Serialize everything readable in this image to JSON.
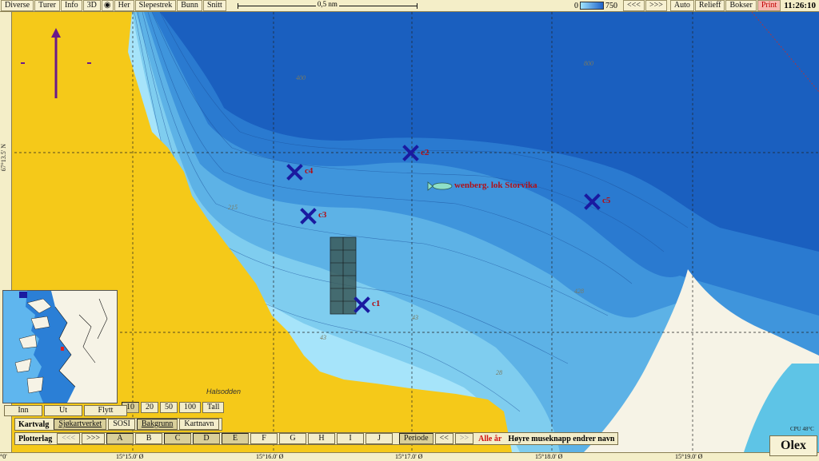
{
  "topbar": {
    "menus": [
      "Diverse",
      "Turer",
      "Info",
      "3D",
      "Her",
      "Slepestrek",
      "Bunn",
      "Snitt"
    ],
    "scale_label": "0,5 nm",
    "depth_min": "0",
    "depth_max": "750",
    "nav_back": "<<<",
    "nav_fwd": ">>>",
    "right_buttons": [
      "Auto",
      "Relieff",
      "Bokser"
    ],
    "print": "Print",
    "clock": "11:26:10"
  },
  "ruler": {
    "latitude": "67°13.5' N",
    "longitudes": [
      "°0'",
      "15°15.0' Ø",
      "15°16.0' Ø",
      "15°17.0' Ø",
      "15°18.0' Ø",
      "15°19.0' Ø"
    ]
  },
  "markers": [
    {
      "label": "c1"
    },
    {
      "label": "c2"
    },
    {
      "label": "c3"
    },
    {
      "label": "c4"
    },
    {
      "label": "c5"
    }
  ],
  "fish_label": "wenberg. lok Storvika",
  "depth_labels": [
    "43",
    "43",
    "28",
    "215",
    "428",
    "400",
    "800"
  ],
  "place_name": "Halsodden",
  "zoom_panel": {
    "scales": [
      "10",
      "20",
      "50",
      "100",
      "Tall"
    ],
    "actions": [
      "Inn",
      "Ut",
      "Flytt"
    ]
  },
  "kartvalg": {
    "label": "Kartvalg",
    "options": [
      "Sjøkartverket",
      "SOSI",
      "Bakgrunn",
      "Kartnavn"
    ]
  },
  "plotterlag": {
    "label": "Plotterlag",
    "back": "<<<",
    "fwd": ">>>",
    "layers": [
      "A",
      "B",
      "C",
      "D",
      "E",
      "F",
      "G",
      "H",
      "I",
      "J"
    ],
    "periode": "Periode",
    "prev": "<<",
    "alle_ar": "Alle år",
    "hint": "Høyre museknapp endrer navn"
  },
  "cpu": "CPU 48°C",
  "logo": "Olex",
  "colors": {
    "land": "#f5c919",
    "deep": "#1a5fbf",
    "shallow": "#9fe3ff",
    "marker": "#1a1aa0",
    "label_red": "#b01018",
    "drying": "#f6f3e6"
  }
}
